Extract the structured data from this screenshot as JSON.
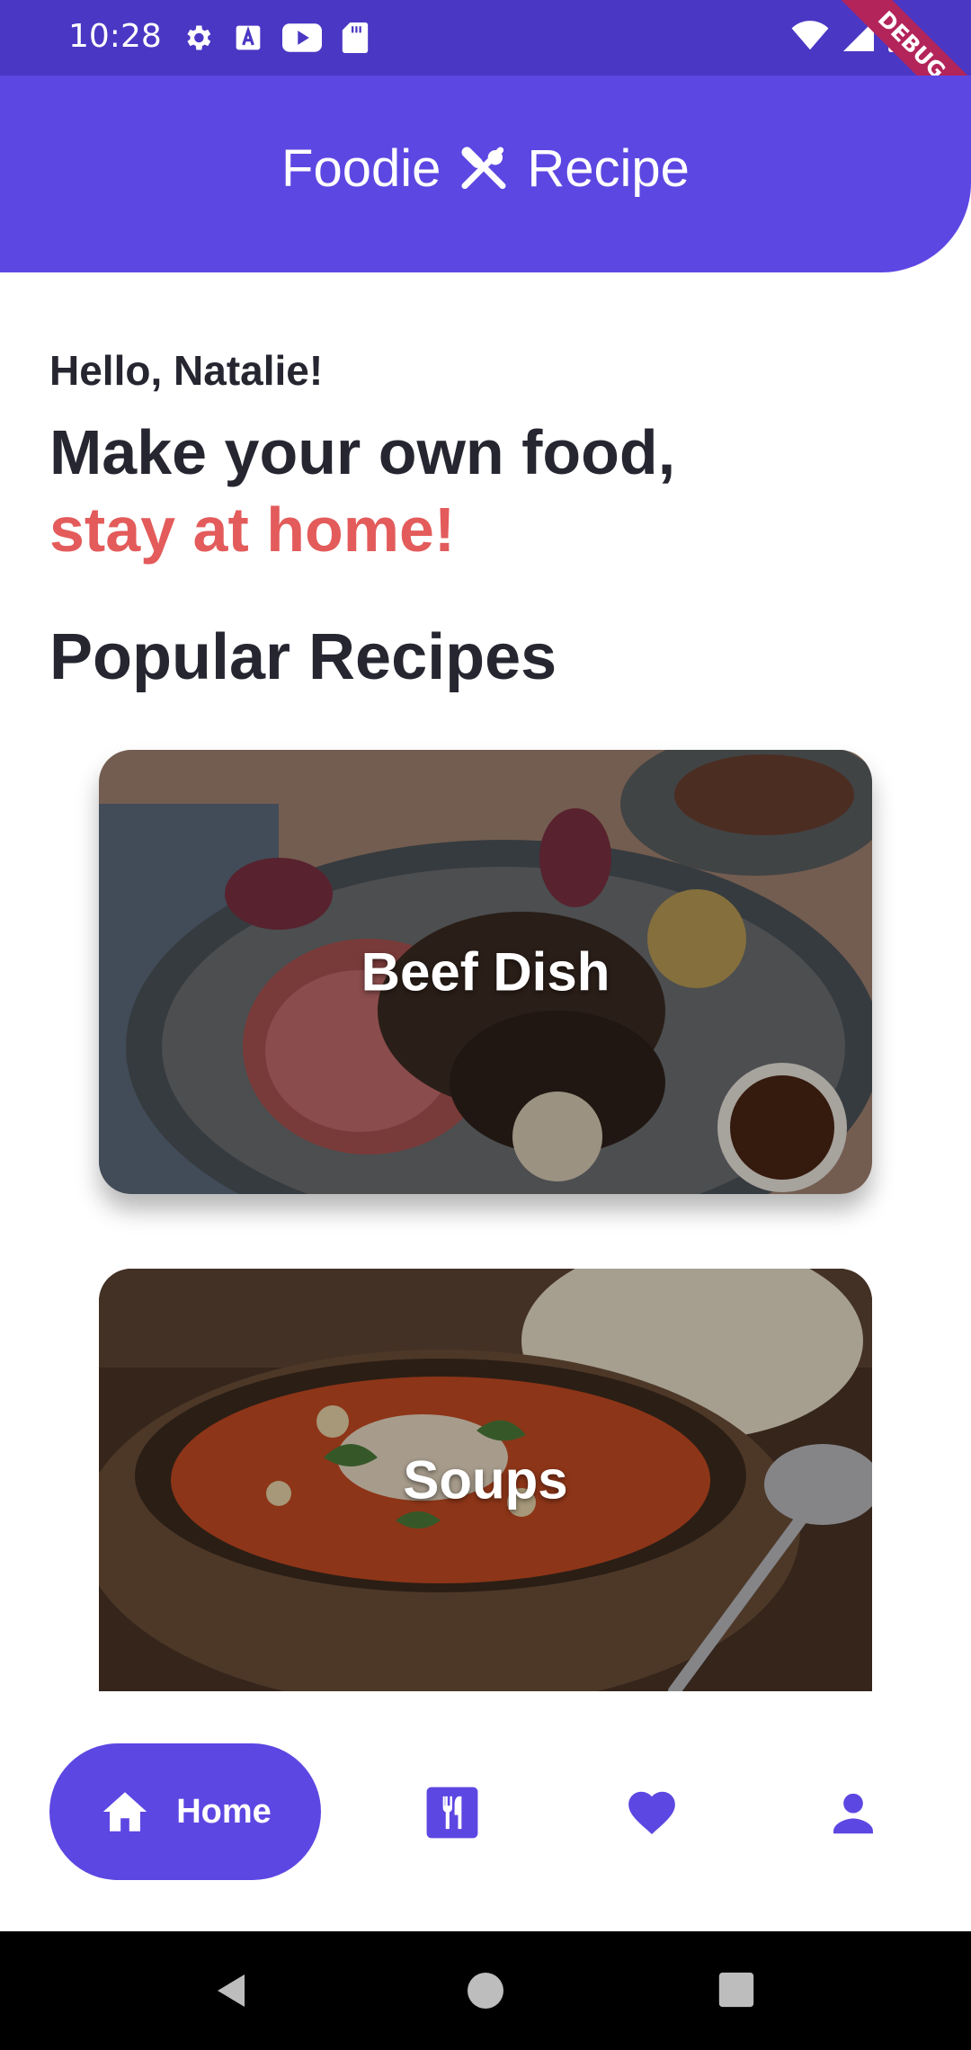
{
  "status_bar": {
    "time": "10:28",
    "icons_left": [
      "gear-icon",
      "a-box-icon",
      "youtube-icon",
      "sd-card-icon"
    ],
    "icons_right": [
      "wifi-icon",
      "signal-icon",
      "battery-icon"
    ],
    "debug_ribbon": "DEBUG"
  },
  "app_bar": {
    "title_left": "Foodie",
    "title_right": "Recipe",
    "icon": "utensils-cross-icon",
    "color": "#5d47e2"
  },
  "greeting": {
    "hello": "Hello, Natalie!",
    "line1": "Make your own food,",
    "line2": "stay at home!",
    "accent_color": "#e35b5b"
  },
  "section": {
    "title": "Popular Recipes"
  },
  "recipes": [
    {
      "label": "Beef Dish",
      "image": "roast-beef-photo"
    },
    {
      "label": "Soups",
      "image": "minestrone-soup-photo"
    }
  ],
  "bottom_nav": {
    "items": [
      {
        "label": "Home",
        "icon": "home-icon",
        "active": true
      },
      {
        "label": "",
        "icon": "restaurant-menu-icon",
        "active": false
      },
      {
        "label": "",
        "icon": "heart-icon",
        "active": false
      },
      {
        "label": "",
        "icon": "person-icon",
        "active": false
      }
    ]
  },
  "system_nav": [
    "back-icon",
    "home-circle-icon",
    "recents-icon"
  ]
}
